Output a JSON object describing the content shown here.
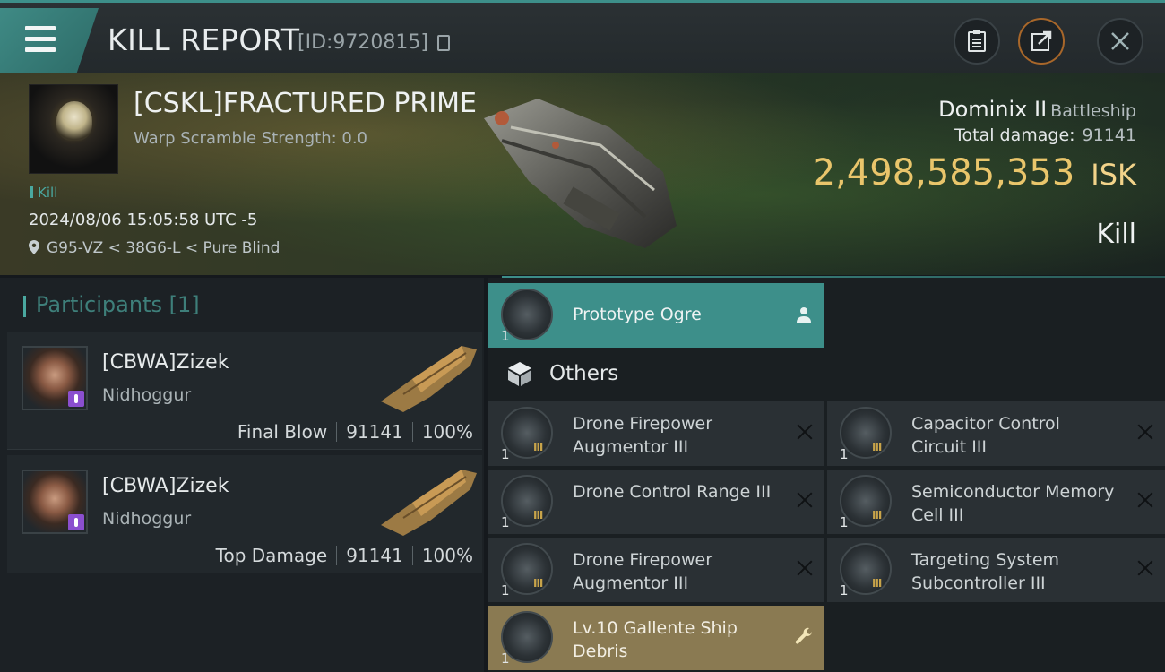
{
  "header": {
    "title": "KILL REPORT",
    "report_id": "[ID:9720815]"
  },
  "victim": {
    "name": "[CSKL]FRACTURED PRIME",
    "warp_scramble": "Warp Scramble Strength: 0.0",
    "kill_tag": "Kill",
    "datetime": "2024/08/06 15:05:58 UTC -5",
    "location": "G95-VZ < 38G6-L < Pure Blind",
    "ship": "Dominix II",
    "ship_class": "Battleship",
    "total_damage_label": "Total damage:",
    "total_damage": "91141",
    "isk_value": "2,498,585,353",
    "isk_unit": "ISK",
    "result": "Kill"
  },
  "participants": {
    "title": "Participants [1]",
    "rows": [
      {
        "name": "[CBWA]Zizek",
        "ship": "Nidhoggur",
        "role": "Final Blow",
        "damage": "91141",
        "percent": "100%"
      },
      {
        "name": "[CBWA]Zizek",
        "ship": "Nidhoggur",
        "role": "Top Damage",
        "damage": "91141",
        "percent": "100%"
      }
    ]
  },
  "items": {
    "drone": {
      "qty": "1",
      "name": "Prototype  Ogre"
    },
    "others_label": "Others",
    "list": [
      {
        "qty": "1",
        "meta": "III",
        "name": "Drone Firepower Augmentor III"
      },
      {
        "qty": "1",
        "meta": "III",
        "name": "Capacitor Control Circuit III"
      },
      {
        "qty": "1",
        "meta": "III",
        "name": "Drone Control Range III"
      },
      {
        "qty": "1",
        "meta": "III",
        "name": "Semiconductor Memory Cell III"
      },
      {
        "qty": "1",
        "meta": "III",
        "name": "Drone Firepower Augmentor III"
      },
      {
        "qty": "1",
        "meta": "III",
        "name": "Targeting System Subcontroller III"
      }
    ],
    "debris": {
      "qty": "1",
      "name": "Lv.10 Gallente Ship Debris"
    }
  },
  "colors": {
    "accent_teal": "#3d8f8a",
    "isk_gold": "#e9c56b",
    "debris_gold": "#8a7a52",
    "badge_purple": "#8b4fcf"
  },
  "icons": [
    "menu-icon",
    "copy-icon",
    "clipboard-icon",
    "share-icon",
    "close-icon",
    "location-pin-icon",
    "user-icon",
    "cube-icon",
    "wrench-icon",
    "remove-x-icon"
  ]
}
